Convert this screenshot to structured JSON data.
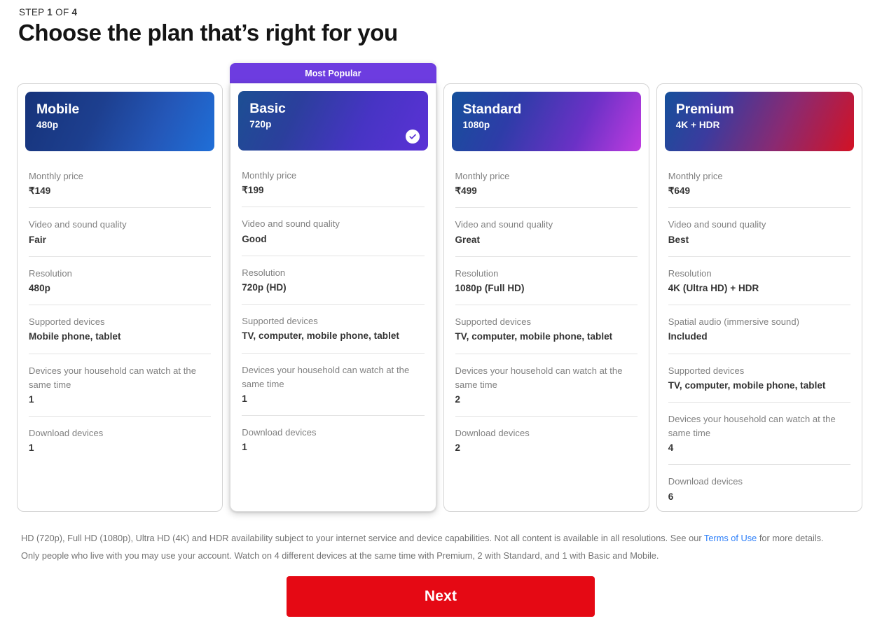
{
  "header": {
    "step_prefix": "STEP ",
    "step_current": "1",
    "step_middle": " OF ",
    "step_total": "4",
    "title": "Choose the plan that’s right for you"
  },
  "popular_badge_label": "Most Popular",
  "plans": [
    {
      "id": "mobile",
      "name": "Mobile",
      "subtitle": "480p",
      "selected": false,
      "most_popular": false,
      "gradient_class": "grad-mobile",
      "features": [
        {
          "label": "Monthly price",
          "value": "₹149"
        },
        {
          "label": "Video and sound quality",
          "value": "Fair"
        },
        {
          "label": "Resolution",
          "value": "480p"
        },
        {
          "label": "Supported devices",
          "value": "Mobile phone, tablet"
        },
        {
          "label": "Devices your household can watch at the same time",
          "value": "1"
        },
        {
          "label": "Download devices",
          "value": "1"
        }
      ]
    },
    {
      "id": "basic",
      "name": "Basic",
      "subtitle": "720p",
      "selected": true,
      "most_popular": true,
      "gradient_class": "grad-basic",
      "features": [
        {
          "label": "Monthly price",
          "value": "₹199"
        },
        {
          "label": "Video and sound quality",
          "value": "Good"
        },
        {
          "label": "Resolution",
          "value": "720p (HD)"
        },
        {
          "label": "Supported devices",
          "value": "TV, computer, mobile phone, tablet"
        },
        {
          "label": "Devices your household can watch at the same time",
          "value": "1"
        },
        {
          "label": "Download devices",
          "value": "1"
        }
      ]
    },
    {
      "id": "standard",
      "name": "Standard",
      "subtitle": "1080p",
      "selected": false,
      "most_popular": false,
      "gradient_class": "grad-standard",
      "features": [
        {
          "label": "Monthly price",
          "value": "₹499"
        },
        {
          "label": "Video and sound quality",
          "value": "Great"
        },
        {
          "label": "Resolution",
          "value": "1080p (Full HD)"
        },
        {
          "label": "Supported devices",
          "value": "TV, computer, mobile phone, tablet"
        },
        {
          "label": "Devices your household can watch at the same time",
          "value": "2"
        },
        {
          "label": "Download devices",
          "value": "2"
        }
      ]
    },
    {
      "id": "premium",
      "name": "Premium",
      "subtitle": "4K + HDR",
      "selected": false,
      "most_popular": false,
      "gradient_class": "grad-premium",
      "features": [
        {
          "label": "Monthly price",
          "value": "₹649"
        },
        {
          "label": "Video and sound quality",
          "value": "Best"
        },
        {
          "label": "Resolution",
          "value": "4K (Ultra HD) + HDR"
        },
        {
          "label": "Spatial audio (immersive sound)",
          "value": "Included"
        },
        {
          "label": "Supported devices",
          "value": "TV, computer, mobile phone, tablet"
        },
        {
          "label": "Devices your household can watch at the same time",
          "value": "4"
        },
        {
          "label": "Download devices",
          "value": "6"
        }
      ]
    }
  ],
  "footnote": {
    "line1_part1": "HD (720p), Full HD (1080p), Ultra HD (4K) and HDR availability subject to your internet service and device capabilities. Not all content is available in all resolutions. See our ",
    "link_label": "Terms of Use",
    "line1_part2": " for more details.",
    "line2": "Only people who live with you may use your account. Watch on 4 different devices at the same time with Premium, 2 with Standard, and 1 with Basic and Mobile."
  },
  "next_button_label": "Next",
  "colors": {
    "brand_red": "#e50914",
    "popular_purple": "#6d3ce0",
    "link_blue": "#2d7ff9",
    "label_gray": "#808080",
    "value_dark": "#333333"
  }
}
